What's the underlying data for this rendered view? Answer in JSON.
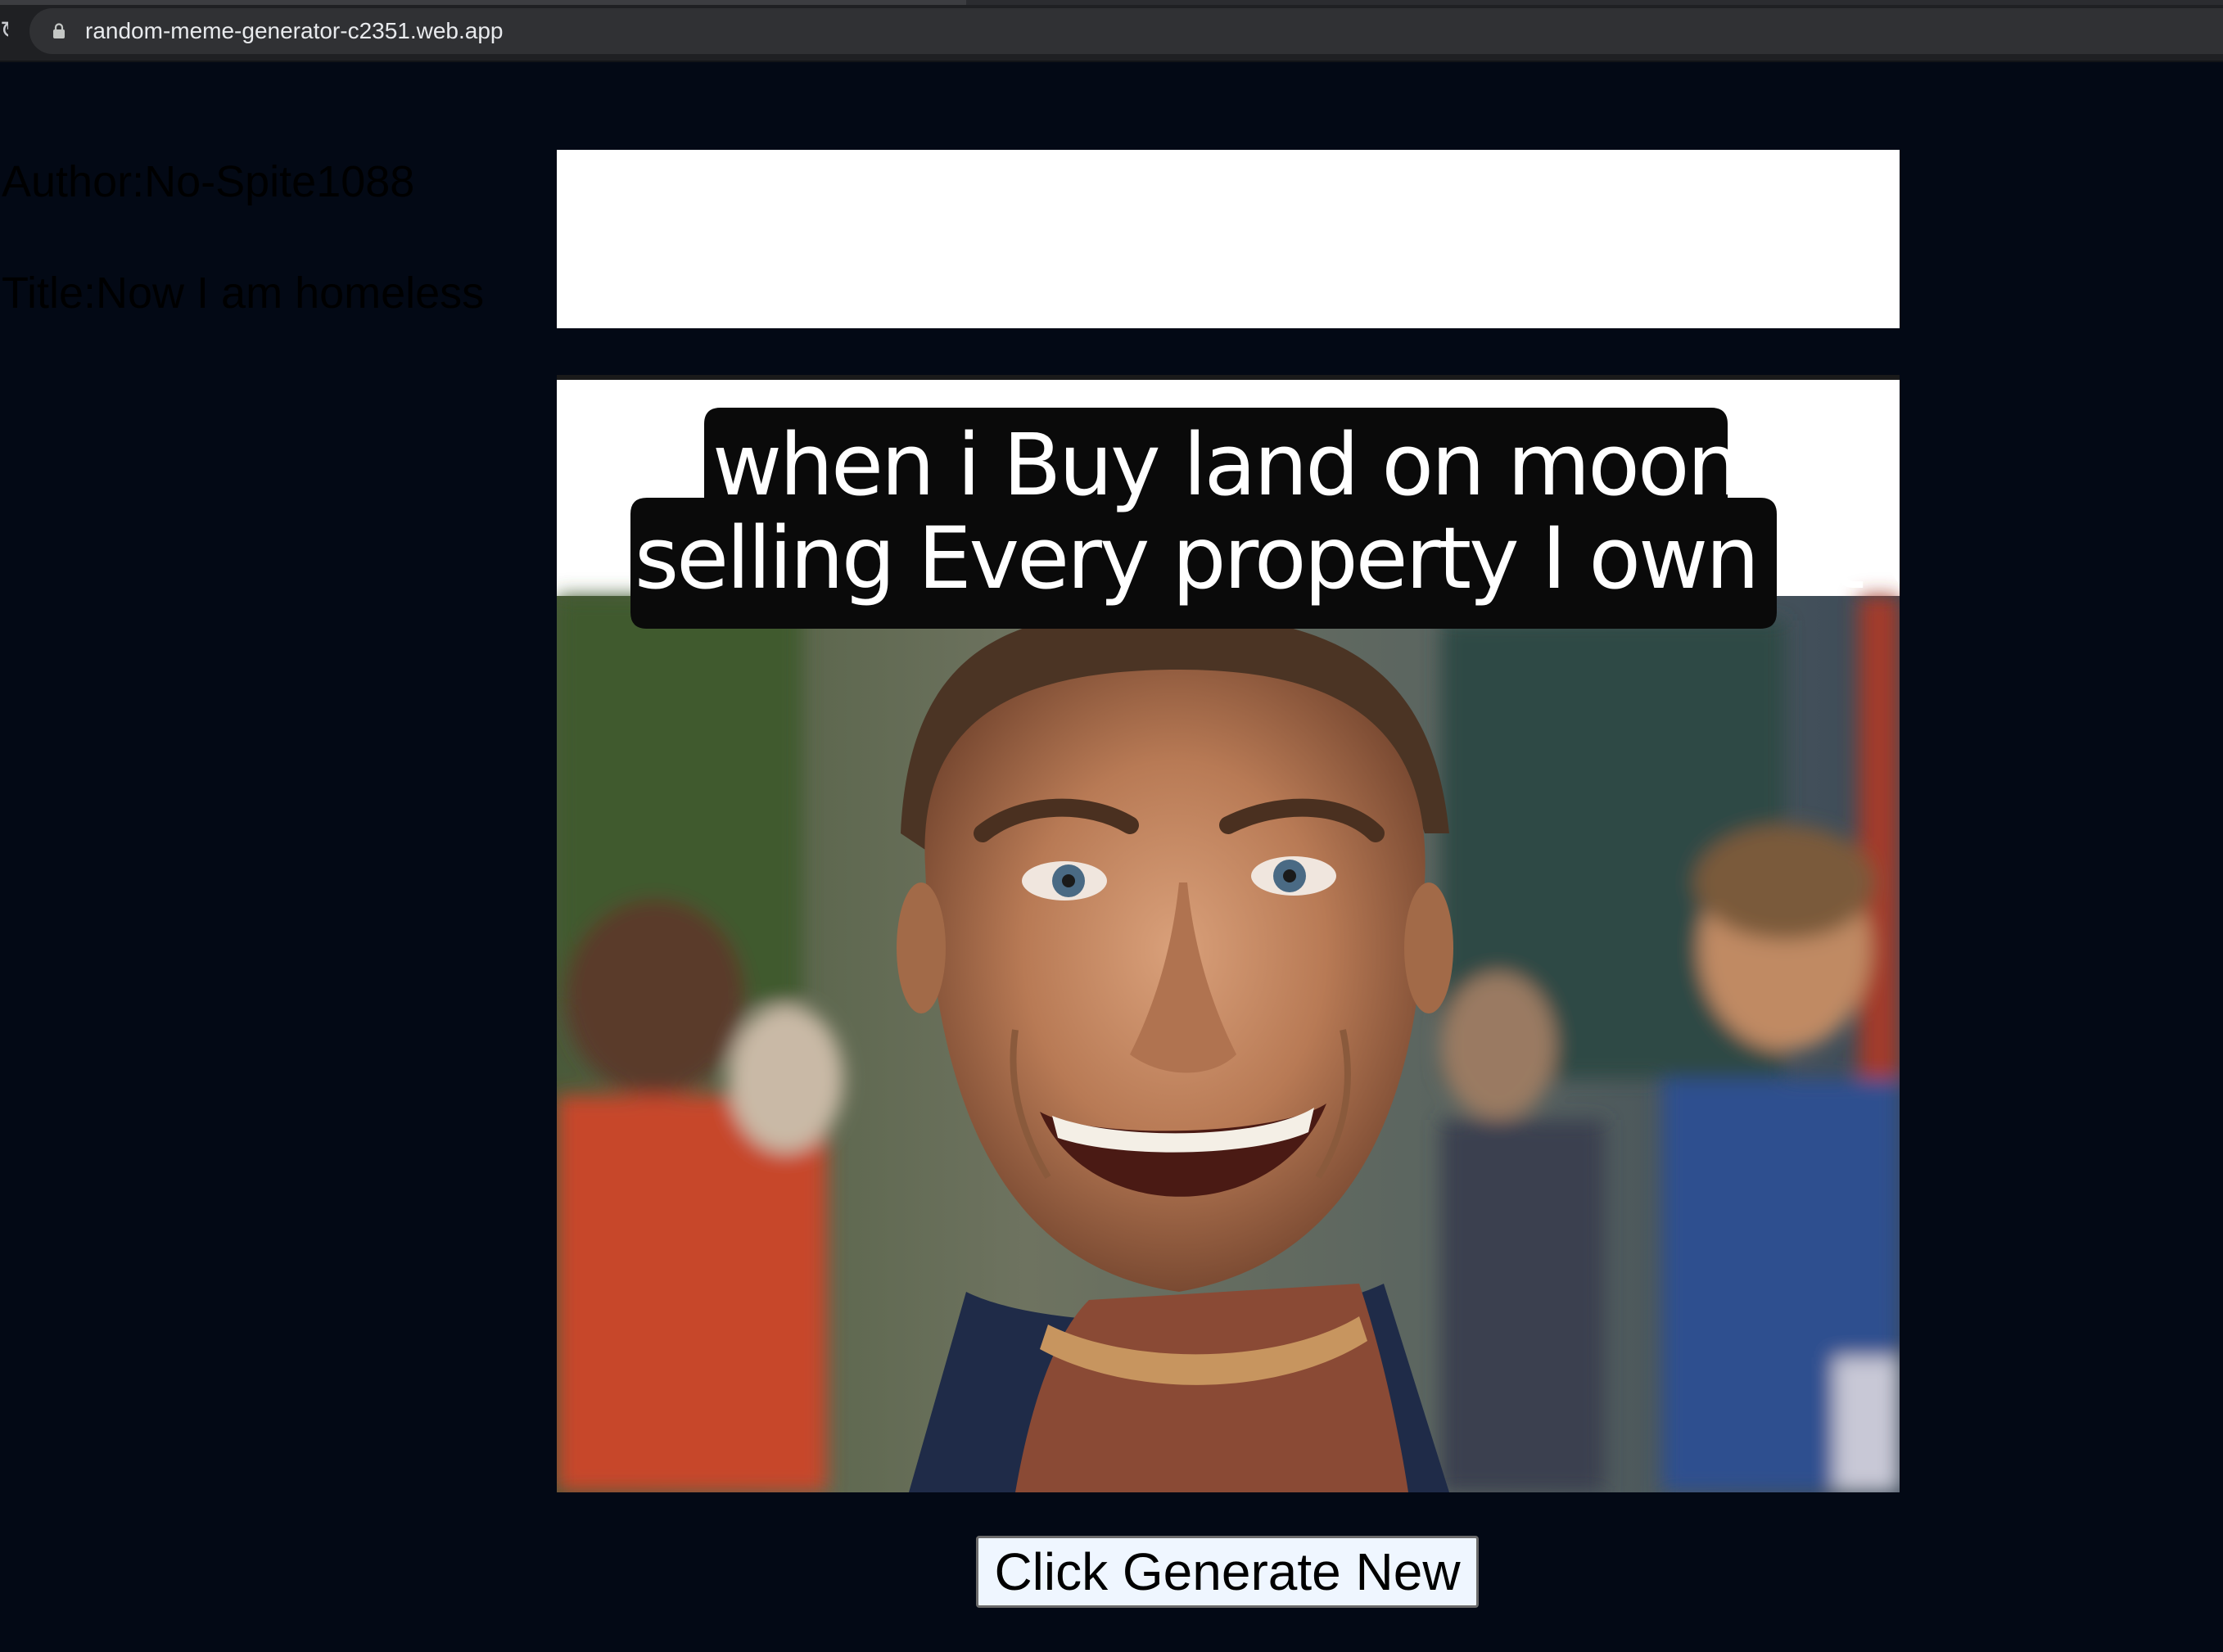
{
  "browser": {
    "url": "random-meme-generator-c2351.web.app"
  },
  "meme": {
    "author_label": "Author:",
    "author": "No-Spite1088",
    "author_line": "Author:No-Spite1088",
    "title_label": "Title:",
    "title": "Now I am homeless",
    "title_line": "Title:Now I am homeless",
    "caption_line_1": "when i Buy land on moon after",
    "caption_line_2": "selling Every property I own at earth"
  },
  "actions": {
    "generate_label": "Click Generate New"
  },
  "colors": {
    "page_background": "#030915",
    "card_background": "#ffffff",
    "button_background": "#eff6ff",
    "browser_chrome": "#1f2023"
  },
  "icons": {
    "lock": "lock-icon",
    "reload": "reload-icon"
  }
}
